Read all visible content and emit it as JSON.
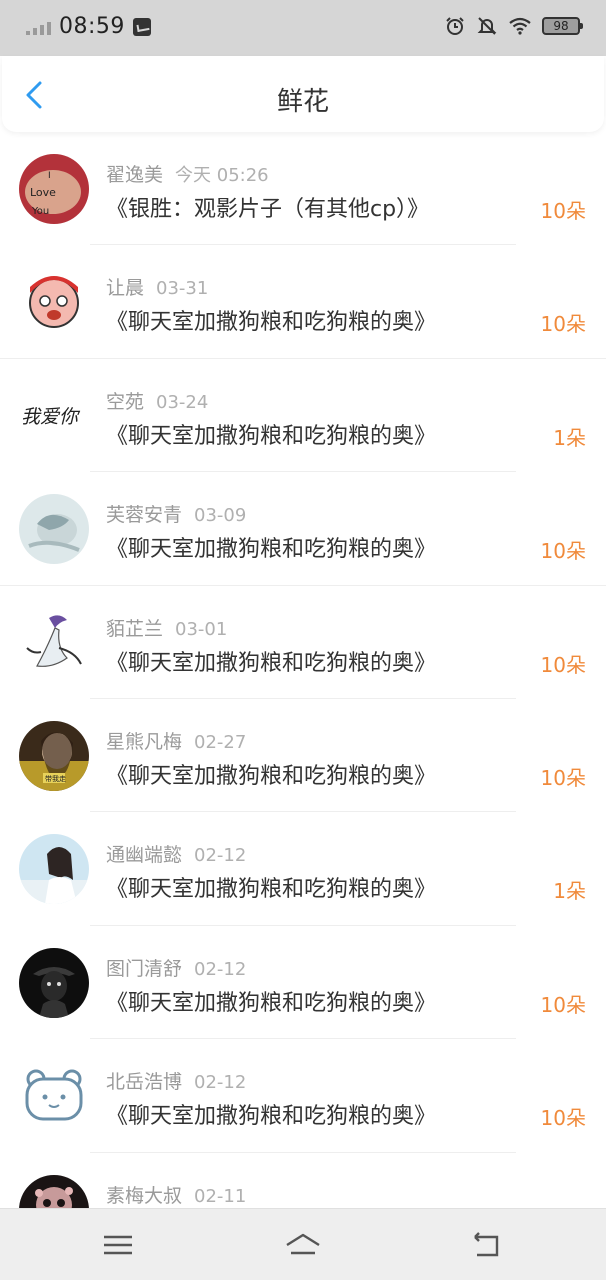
{
  "status_bar": {
    "time": "08:59",
    "battery": "98"
  },
  "header": {
    "title": "鲜花"
  },
  "list": [
    {
      "name": "翟逸美",
      "date": "今天 05:26",
      "book": "《银胜：观影片子（有其他cp）》",
      "amount": "10朵",
      "avatar": "photo-love-hand"
    },
    {
      "name": "让晨",
      "date": "03-31",
      "book": "《聊天室加撒狗粮和吃狗粮的奥》",
      "amount": "10朵",
      "avatar": "cartoon-face"
    },
    {
      "name": "空苑",
      "date": "03-24",
      "book": "《聊天室加撒狗粮和吃狗粮的奥》",
      "amount": "1朵",
      "avatar": "calligraphy-text"
    },
    {
      "name": "芙蓉安青",
      "date": "03-09",
      "book": "《聊天室加撒狗粮和吃狗粮的奥》",
      "amount": "10朵",
      "avatar": "anime-sleeping"
    },
    {
      "name": "貊芷兰",
      "date": "03-01",
      "book": "《聊天室加撒狗粮和吃狗粮的奥》",
      "amount": "10朵",
      "avatar": "pokemon-gardevoir"
    },
    {
      "name": "星熊凡梅",
      "date": "02-27",
      "book": "《聊天室加撒狗粮和吃狗粮的奥》",
      "amount": "10朵",
      "avatar": "photo-girl"
    },
    {
      "name": "通幽端懿",
      "date": "02-12",
      "book": "《聊天室加撒狗粮和吃狗粮的奥》",
      "amount": "1朵",
      "avatar": "photo-girl-sky"
    },
    {
      "name": "图门清舒",
      "date": "02-12",
      "book": "《聊天室加撒狗粮和吃狗粮的奥》",
      "amount": "10朵",
      "avatar": "dark-portrait"
    },
    {
      "name": "北岳浩博",
      "date": "02-12",
      "book": "《聊天室加撒狗粮和吃狗粮的奥》",
      "amount": "10朵",
      "avatar": "bear-icon"
    },
    {
      "name": "素梅大叔",
      "date": "02-11",
      "book": "",
      "amount": "",
      "avatar": "floral-skull"
    }
  ],
  "avatar_inline_text": {
    "love_hand": [
      "I",
      "Love",
      "You"
    ],
    "calligraphy": "我爱你",
    "girl_caption": "带我走"
  },
  "colors": {
    "accent_blue": "#2f9bf0",
    "amount_orange": "#f08a3b",
    "statusbar_bg": "#d6d6d6",
    "navbar_bg": "#eeeeee"
  }
}
